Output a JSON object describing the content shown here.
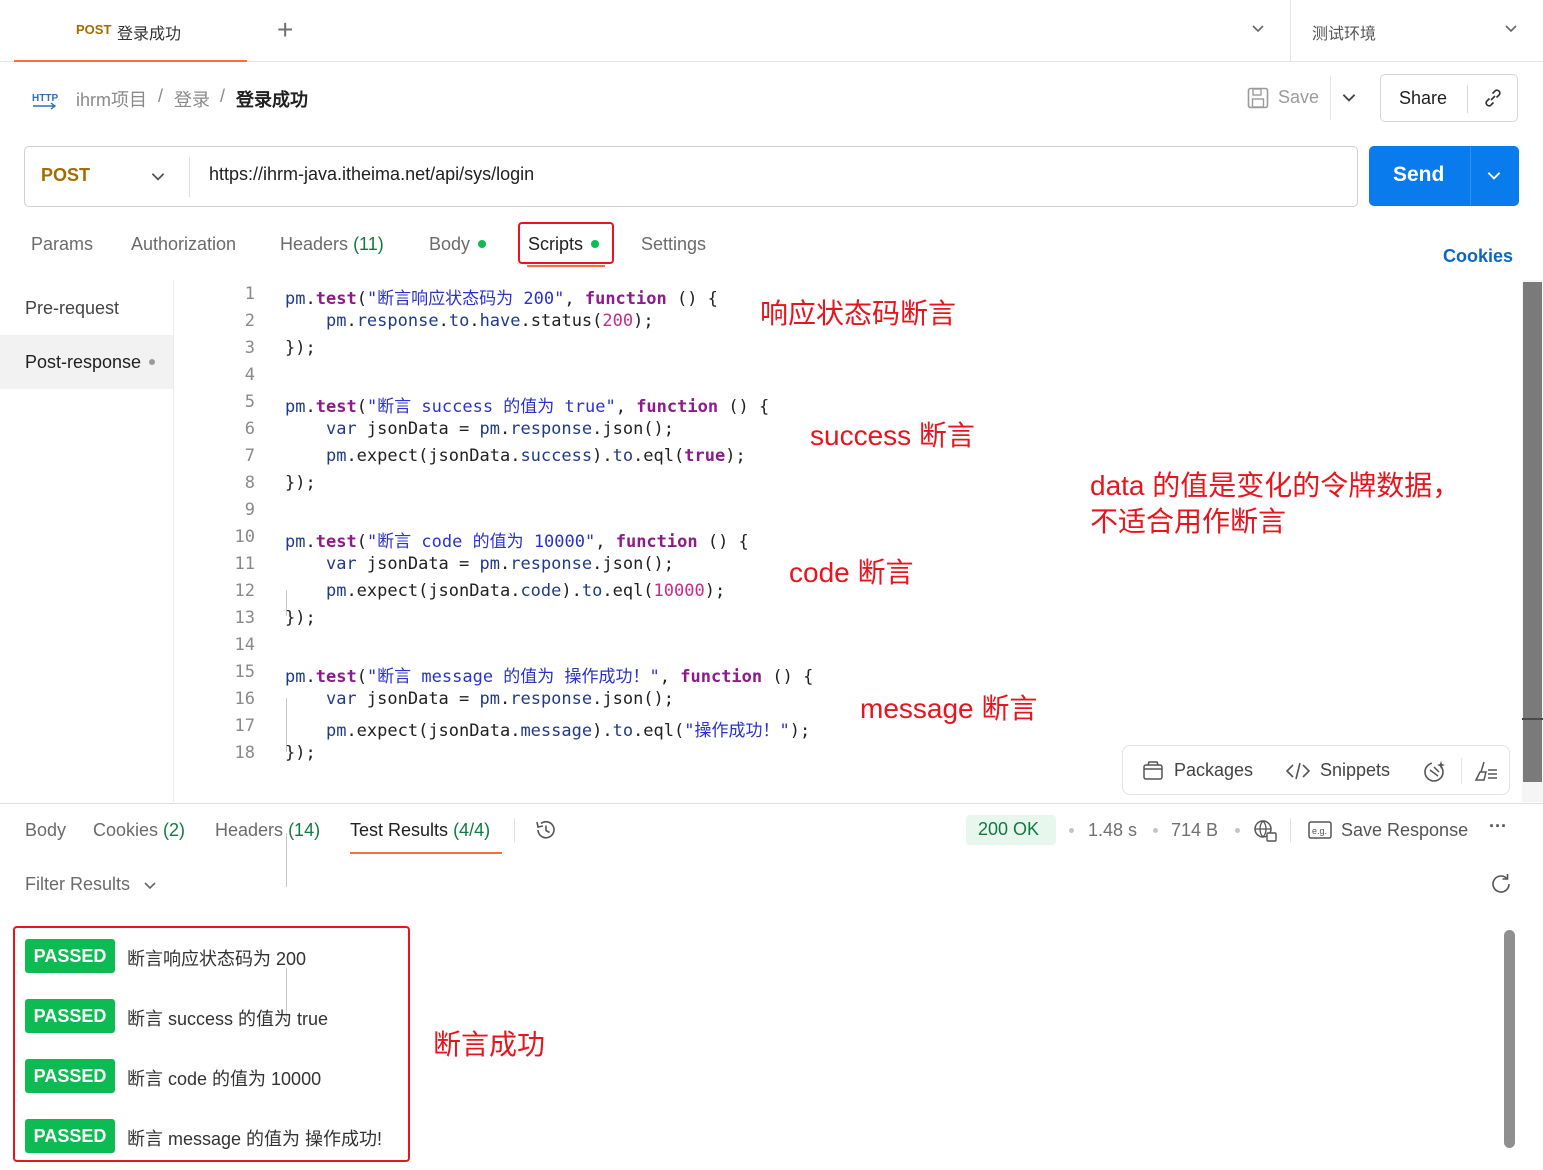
{
  "top_tab": {
    "method": "POST",
    "name": "登录成功",
    "new_tab": "+"
  },
  "environment": {
    "name": "测试环境"
  },
  "breadcrumb": {
    "http_icon": "HTTP",
    "items": [
      "ihrm项目",
      "登录",
      "登录成功"
    ],
    "sep": "/"
  },
  "actions": {
    "save": "Save",
    "share": "Share"
  },
  "request": {
    "method": "POST",
    "url": "https://ihrm-java.itheima.net/api/sys/login",
    "send": "Send"
  },
  "request_tabs": {
    "params": "Params",
    "authorization": "Authorization",
    "headers": "Headers",
    "headers_count": "(11)",
    "body": "Body",
    "scripts": "Scripts",
    "settings": "Settings",
    "cookies": "Cookies"
  },
  "script_nav": {
    "pre_request": "Pre-request",
    "post_response": "Post-response"
  },
  "code_line_numbers": [
    "1",
    "2",
    "3",
    "4",
    "5",
    "6",
    "7",
    "8",
    "9",
    "10",
    "11",
    "12",
    "13",
    "14",
    "15",
    "16",
    "17",
    "18"
  ],
  "annotations": {
    "status": "响应状态码断言",
    "success": "success 断言",
    "code": "code 断言",
    "message": "message 断言",
    "data_note_1": "data 的值是变化的令牌数据，",
    "data_note_2": "不适合用作断言",
    "passed_note": "断言成功"
  },
  "editor_tools": {
    "packages": "Packages",
    "snippets": "Snippets"
  },
  "response_tabs": {
    "body": "Body",
    "cookies": "Cookies",
    "cookies_count": "(2)",
    "headers": "Headers",
    "headers_count": "(14)",
    "test_results": "Test Results",
    "test_results_count": "(4/4)"
  },
  "response_meta": {
    "status": "200 OK",
    "time": "1.48 s",
    "size": "714 B",
    "save_response": "Save Response",
    "more": "···"
  },
  "filter": {
    "label": "Filter Results"
  },
  "tests": [
    {
      "status": "PASSED",
      "name": "断言响应状态码为 200"
    },
    {
      "status": "PASSED",
      "name": "断言 success 的值为 true"
    },
    {
      "status": "PASSED",
      "name": "断言 code 的值为 10000"
    },
    {
      "status": "PASSED",
      "name": "断言 message 的值为 操作成功!"
    }
  ],
  "colors": {
    "accent": "#ff6c37",
    "send": "#097bed",
    "passed": "#0cbb52",
    "annotation": "#e8141e",
    "method": "#a36b00"
  }
}
